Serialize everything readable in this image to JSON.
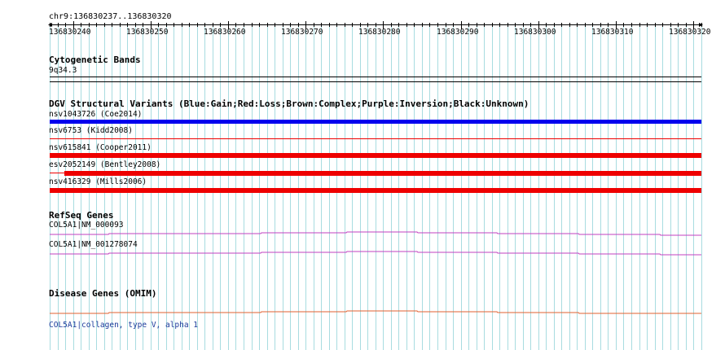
{
  "region": "chr9:136830237..136830320",
  "ruler": {
    "ticks": [
      "136830240",
      "136830250",
      "136830260",
      "136830270",
      "136830280",
      "136830290",
      "136830300",
      "136830310",
      "136830320"
    ]
  },
  "cytoband": {
    "title": "Cytogenetic Bands",
    "band": "9q34.3"
  },
  "dgv": {
    "title": "DGV Structural Variants (Blue:Gain;Red:Loss;Brown:Complex;Purple:Inversion;Black:Unknown)",
    "variants": [
      {
        "label": "nsv1043726 (Coe2014)",
        "type": "gain",
        "color": "#0000ee"
      },
      {
        "label": "nsv6753 (Kidd2008)",
        "type": "loss",
        "color": "#ee0000"
      },
      {
        "label": "nsv615841 (Cooper2011)",
        "type": "loss",
        "color": "#ee0000"
      },
      {
        "label": "esv2052149 (Bentley2008)",
        "type": "loss",
        "color": "#ee0000"
      },
      {
        "label": "nsv416329 (Mills2006)",
        "type": "loss",
        "color": "#ee0000"
      }
    ]
  },
  "refseq": {
    "title": "RefSeq Genes",
    "genes": [
      {
        "label": "COL5A1|NM_000093",
        "color": "#c040c0"
      },
      {
        "label": "COL5A1|NM_001278074",
        "color": "#c040c0"
      }
    ]
  },
  "omim": {
    "title": "Disease Genes (OMIM)",
    "gene_label": "COL5A1|collagen, type V, alpha 1",
    "color": "#e06030"
  },
  "colors": {
    "grid": "#a8dce0",
    "gain": "#0000ee",
    "loss": "#ee0000",
    "refseq": "#c040c0",
    "omim": "#e06030",
    "link": "#1a3a9a"
  }
}
